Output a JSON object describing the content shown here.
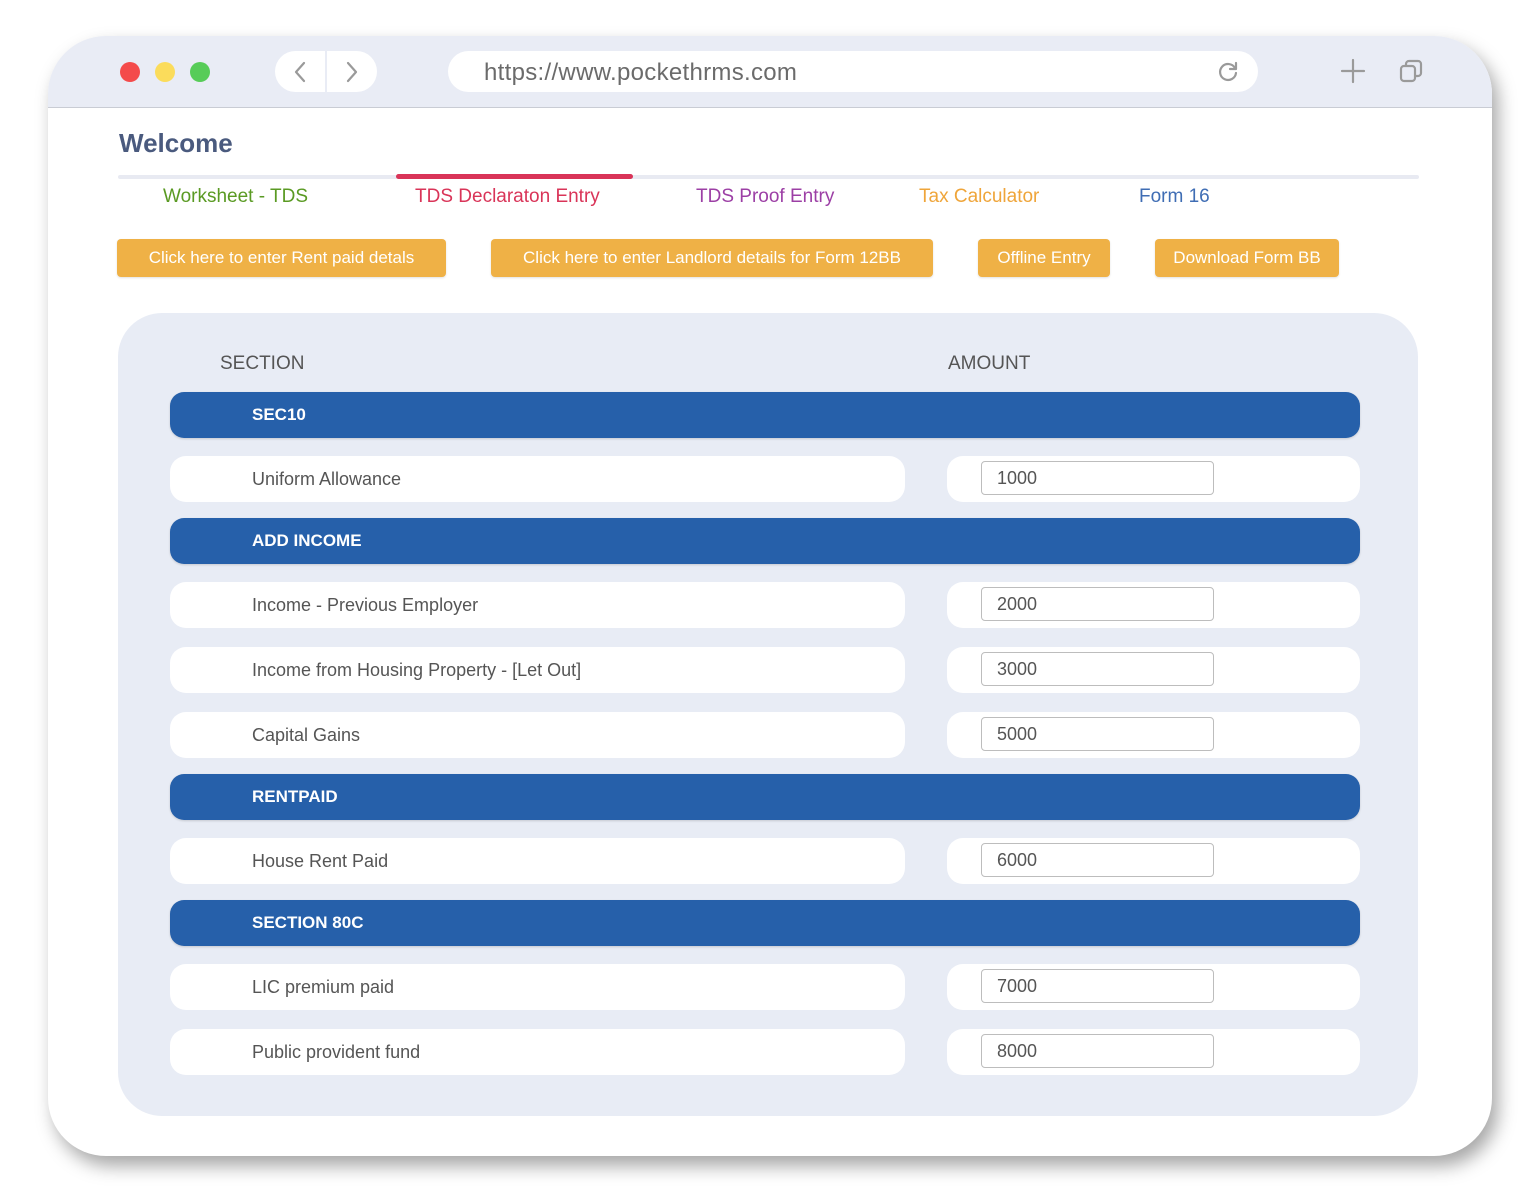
{
  "browser": {
    "url": "https://www.pockethrms.com",
    "traffic_lights": [
      "close",
      "minimize",
      "maximize"
    ]
  },
  "page": {
    "title": "Welcome",
    "tabs": [
      {
        "label": "Worksheet - TDS",
        "color": "#5a9a23",
        "active": false
      },
      {
        "label": "TDS Declaraton Entry",
        "color": "#d93458",
        "active": true
      },
      {
        "label": "TDS Proof Entry",
        "color": "#9c3fa5",
        "active": false
      },
      {
        "label": "Tax Calculator",
        "color": "#efa53a",
        "active": false
      },
      {
        "label": "Form 16",
        "color": "#3f6db4",
        "active": false
      }
    ],
    "actions": [
      {
        "label": "Click here to enter Rent paid detals"
      },
      {
        "label": "Click here to enter Landlord details for Form 12BB"
      },
      {
        "label": "Offline Entry"
      },
      {
        "label": "Download Form BB"
      }
    ]
  },
  "table": {
    "headers": {
      "section": "SECTION",
      "amount": "AMOUNT"
    },
    "sections": [
      {
        "title": "SEC10",
        "items": [
          {
            "label": "Uniform Allowance",
            "amount": "1000"
          }
        ]
      },
      {
        "title": "ADD INCOME",
        "items": [
          {
            "label": "Income - Previous Employer",
            "amount": "2000"
          },
          {
            "label": "Income from Housing Property - [Let Out]",
            "amount": "3000"
          },
          {
            "label": "Capital Gains",
            "amount": "5000"
          }
        ]
      },
      {
        "title": "RENTPAID",
        "items": [
          {
            "label": "House Rent Paid",
            "amount": "6000"
          }
        ]
      },
      {
        "title": "SECTION 80C",
        "items": [
          {
            "label": "LIC premium paid",
            "amount": "7000"
          },
          {
            "label": "Public provident fund",
            "amount": "8000"
          }
        ]
      }
    ]
  },
  "colors": {
    "section_header": "#2660aa",
    "action_button": "#efb146",
    "active_tab_indicator": "#d93458",
    "panel_background": "#e8ecf5"
  }
}
